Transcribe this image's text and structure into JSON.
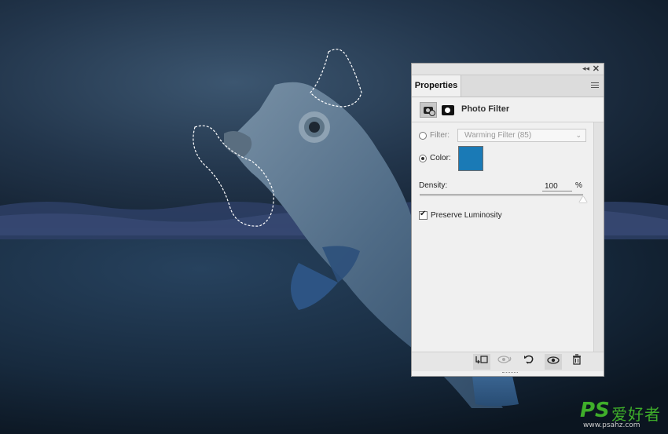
{
  "panel": {
    "tab_label": "Properties",
    "collapse_glyph": "◂◂",
    "close_glyph": "✕",
    "adjustment_title": "Photo Filter",
    "filter": {
      "label": "Filter:",
      "selected": "Warming Filter (85)",
      "selected_state": false
    },
    "color": {
      "label": "Color:",
      "selected_state": true,
      "swatch_hex": "#1a7ab6"
    },
    "density": {
      "label": "Density:",
      "value": "100",
      "unit": "%",
      "level_fraction": 1.0
    },
    "preserve_luminosity": {
      "label": "Preserve Luminosity",
      "checked": true
    },
    "bottom_buttons": [
      {
        "name": "clip-to-layer-icon",
        "glyph": "↲"
      },
      {
        "name": "view-previous-state-icon",
        "glyph": "◉"
      },
      {
        "name": "reset-icon",
        "glyph": "↺"
      },
      {
        "name": "visibility-eye-icon",
        "glyph": "◉"
      },
      {
        "name": "trash-icon",
        "glyph": "🗑"
      }
    ]
  },
  "watermark": {
    "brand": "PS",
    "chinese": "爱好者",
    "url": "www.psahz.com"
  }
}
